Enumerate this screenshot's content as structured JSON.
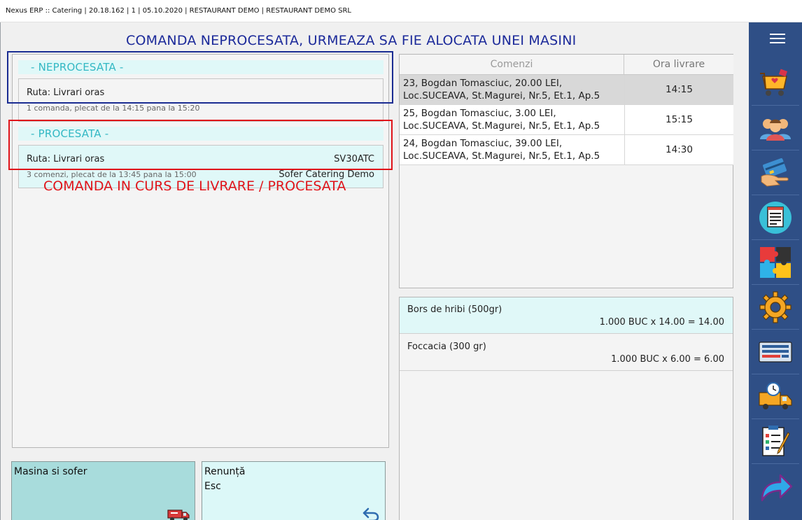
{
  "window": {
    "title": "Nexus ERP :: Catering | 20.18.162 | 1 | 05.10.2020 | RESTAURANT DEMO | RESTAURANT DEMO SRL"
  },
  "routes": {
    "unprocessed_header": "- NEPROCESATA -",
    "processed_header": "- PROCESATA -",
    "unprocessed": [
      {
        "title": "Ruta: Livrari oras",
        "subtitle": "1 comanda, plecat de la 14:15 pana la 15:20"
      }
    ],
    "processed": [
      {
        "title": "Ruta: Livrari oras",
        "subtitle": "3 comenzi, plecat de la 13:45 pana la 15:00",
        "plate": "SV30ATC",
        "driver": "Sofer Catering Demo"
      }
    ]
  },
  "annotations": {
    "blue": "COMANDA NEPROCESATA, URMEAZA SA FIE ALOCATA UNEI MASINI",
    "red": "COMANDA IN CURS DE LIVRARE / PROCESATA"
  },
  "orders": {
    "columns": [
      "Comenzi",
      "Ora livrare"
    ],
    "rows": [
      {
        "line1": "23, Bogdan Tomasciuc, 20.00 LEI,",
        "line2": "Loc.SUCEAVA, St.Magurei, Nr.5, Et.1, Ap.5",
        "time": "14:15",
        "selected": true
      },
      {
        "line1": "25, Bogdan Tomasciuc, 3.00 LEI,",
        "line2": "Loc.SUCEAVA, St.Magurei, Nr.5, Et.1, Ap.5",
        "time": "15:15",
        "selected": false
      },
      {
        "line1": "24, Bogdan Tomasciuc, 39.00 LEI,",
        "line2": "Loc.SUCEAVA, St.Magurei, Nr.5, Et.1, Ap.5",
        "time": "14:30",
        "selected": false
      }
    ]
  },
  "items": [
    {
      "name": "Bors de hribi (500gr)",
      "calc": "1.000 BUC x 14.00 = 14.00",
      "highlighted": true
    },
    {
      "name": "Foccacia (300 gr)",
      "calc": "1.000 BUC x 6.00 = 6.00",
      "highlighted": false
    }
  ],
  "buttons": {
    "car_driver": "Masina si sofer",
    "cancel": "Renunță\nEsc"
  },
  "sidebar": {
    "items": [
      "menu-icon",
      "delivery-cart-icon",
      "customers-icon",
      "payment-card-icon",
      "receipt-icon",
      "puzzle-icon",
      "settings-gear-icon",
      "keyboard-icon",
      "delivery-van-icon",
      "checklist-icon",
      "exit-arrow-icon"
    ]
  },
  "colors": {
    "sidebar_bg": "#2f4f86",
    "header_accent": "#33b8c4",
    "blue_annotation": "#1c2a9a",
    "red_annotation": "#e0141a",
    "button_primary": "#a8dcdc",
    "button_secondary": "#dcf8f8",
    "selected_row": "#d8d8d8",
    "highlight_row": "#e0f8f8"
  }
}
